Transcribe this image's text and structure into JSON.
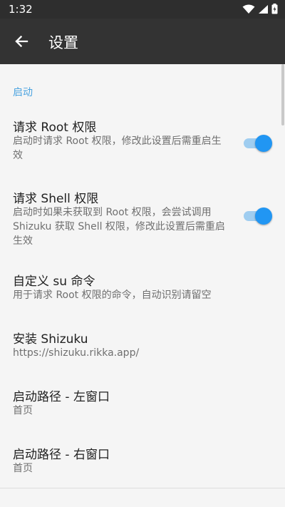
{
  "status_bar": {
    "time": "1:32",
    "icons": [
      "wifi-icon",
      "signal-icon",
      "battery-icon"
    ]
  },
  "app_bar": {
    "title": "设置",
    "back_icon": "arrow-left-icon"
  },
  "category": "启动",
  "preferences": [
    {
      "title": "请求 Root 权限",
      "summary": "启动时请求 Root 权限，修改此设置后需重启生效",
      "switch_on": true
    },
    {
      "title": "请求 Shell 权限",
      "summary": "启动时如果未获取到 Root 权限，会尝试调用 Shizuku 获取 Shell 权限，修改此设置后需重启生效",
      "switch_on": true
    },
    {
      "title": "自定义 su 命令",
      "summary": "用于请求 Root 权限的命令，自动识别请留空"
    },
    {
      "title": "安装 Shizuku",
      "summary": "https://shizuku.rikka.app/"
    },
    {
      "title": "启动路径 - 左窗口",
      "summary": "首页"
    },
    {
      "title": "启动路径 - 右窗口",
      "summary": "首页"
    }
  ],
  "colors": {
    "accent": "#2196f3",
    "category": "#4aa3e0",
    "app_bar": "#333333",
    "status_bar": "#2e2e2e"
  }
}
